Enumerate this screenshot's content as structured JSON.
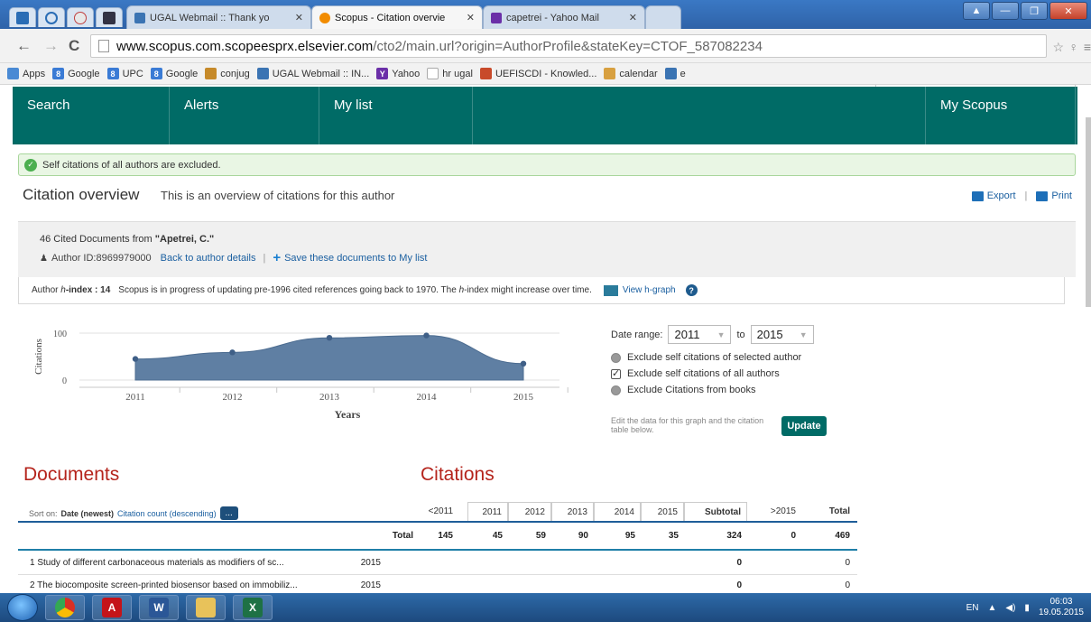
{
  "browser": {
    "tabs": [
      {
        "label": "UGAL Webmail :: Thank yo",
        "active": false
      },
      {
        "label": "Scopus - Citation overvie",
        "active": true
      },
      {
        "label": "capetrei - Yahoo Mail",
        "active": false
      }
    ],
    "url_host": "www.scopus.com.scopeesprx.elsevier.com",
    "url_path": "/cto2/main.url?origin=AuthorProfile&stateKey=CTOF_587082234",
    "bookmarks": [
      "Apps",
      "Google",
      "UPC",
      "Google",
      "conjug",
      "UGAL Webmail :: IN...",
      "Yahoo",
      "hr ugal",
      "UEFISCDI - Knowled...",
      "calendar",
      "e"
    ]
  },
  "nav": {
    "items": [
      "Search",
      "Alerts",
      "My list",
      "",
      "My Scopus"
    ]
  },
  "notice": "Self citations of all authors are excluded.",
  "overview": {
    "title": "Citation overview",
    "subtitle": "This is an overview of citations for this author",
    "export": "Export",
    "print": "Print"
  },
  "author": {
    "cited_prefix": "46 Cited Documents from",
    "name": "\"Apetrei, C.\"",
    "id_label": "Author ID:8969979000",
    "back_link": "Back to author details",
    "save_link": "Save these documents to My list"
  },
  "hindex": {
    "label": "Author",
    "h": "h",
    "label_rest": "-index : 14",
    "note_a": "Scopus is in progress of updating pre-1996 cited references going back to 1970. The",
    "note_h": "h",
    "note_b": "-index might increase over time.",
    "view_link": "View h-graph"
  },
  "chart_data": {
    "type": "area",
    "categories": [
      "2011",
      "2012",
      "2013",
      "2014",
      "2015"
    ],
    "values": [
      45,
      59,
      90,
      95,
      35
    ],
    "xlabel": "Years",
    "ylabel": "Citations",
    "ylim": [
      0,
      100
    ],
    "yticks": [
      "100",
      "0"
    ],
    "color": "#5f7fa3"
  },
  "date_range": {
    "label": "Date range:",
    "from": "2011",
    "to_label": "to",
    "to": "2015",
    "options": [
      {
        "label": "Exclude self citations of selected author",
        "checked": false
      },
      {
        "label": "Exclude self citations of all authors",
        "checked": true
      },
      {
        "label": "Exclude Citations from books",
        "checked": false
      }
    ],
    "note": "Edit the data for this graph and the citation table below.",
    "update": "Update"
  },
  "documents": {
    "heading": "Documents",
    "citations_heading": "Citations",
    "sort_label": "Sort on:",
    "sort_active": "Date (newest)",
    "sort_other": "Citation count (descending)",
    "sort_more": "...",
    "columns": [
      "<2011",
      "2011",
      "2012",
      "2013",
      "2014",
      "2015",
      "Subtotal",
      ">2015",
      "Total"
    ],
    "total_label": "Total",
    "totals": [
      "145",
      "45",
      "59",
      "90",
      "95",
      "35",
      "324",
      "0",
      "469"
    ],
    "rows": [
      {
        "title": "1  Study of different carbonaceous materials as modifiers of sc...",
        "year": "2015",
        "subtotal": "0",
        "total": "0"
      },
      {
        "title": "2  The biocomposite screen-printed biosensor based on immobiliz...",
        "year": "2015",
        "subtotal": "0",
        "total": "0"
      }
    ]
  },
  "taskbar": {
    "lang": "EN",
    "time": "06:03",
    "date": "19.05.2015"
  }
}
